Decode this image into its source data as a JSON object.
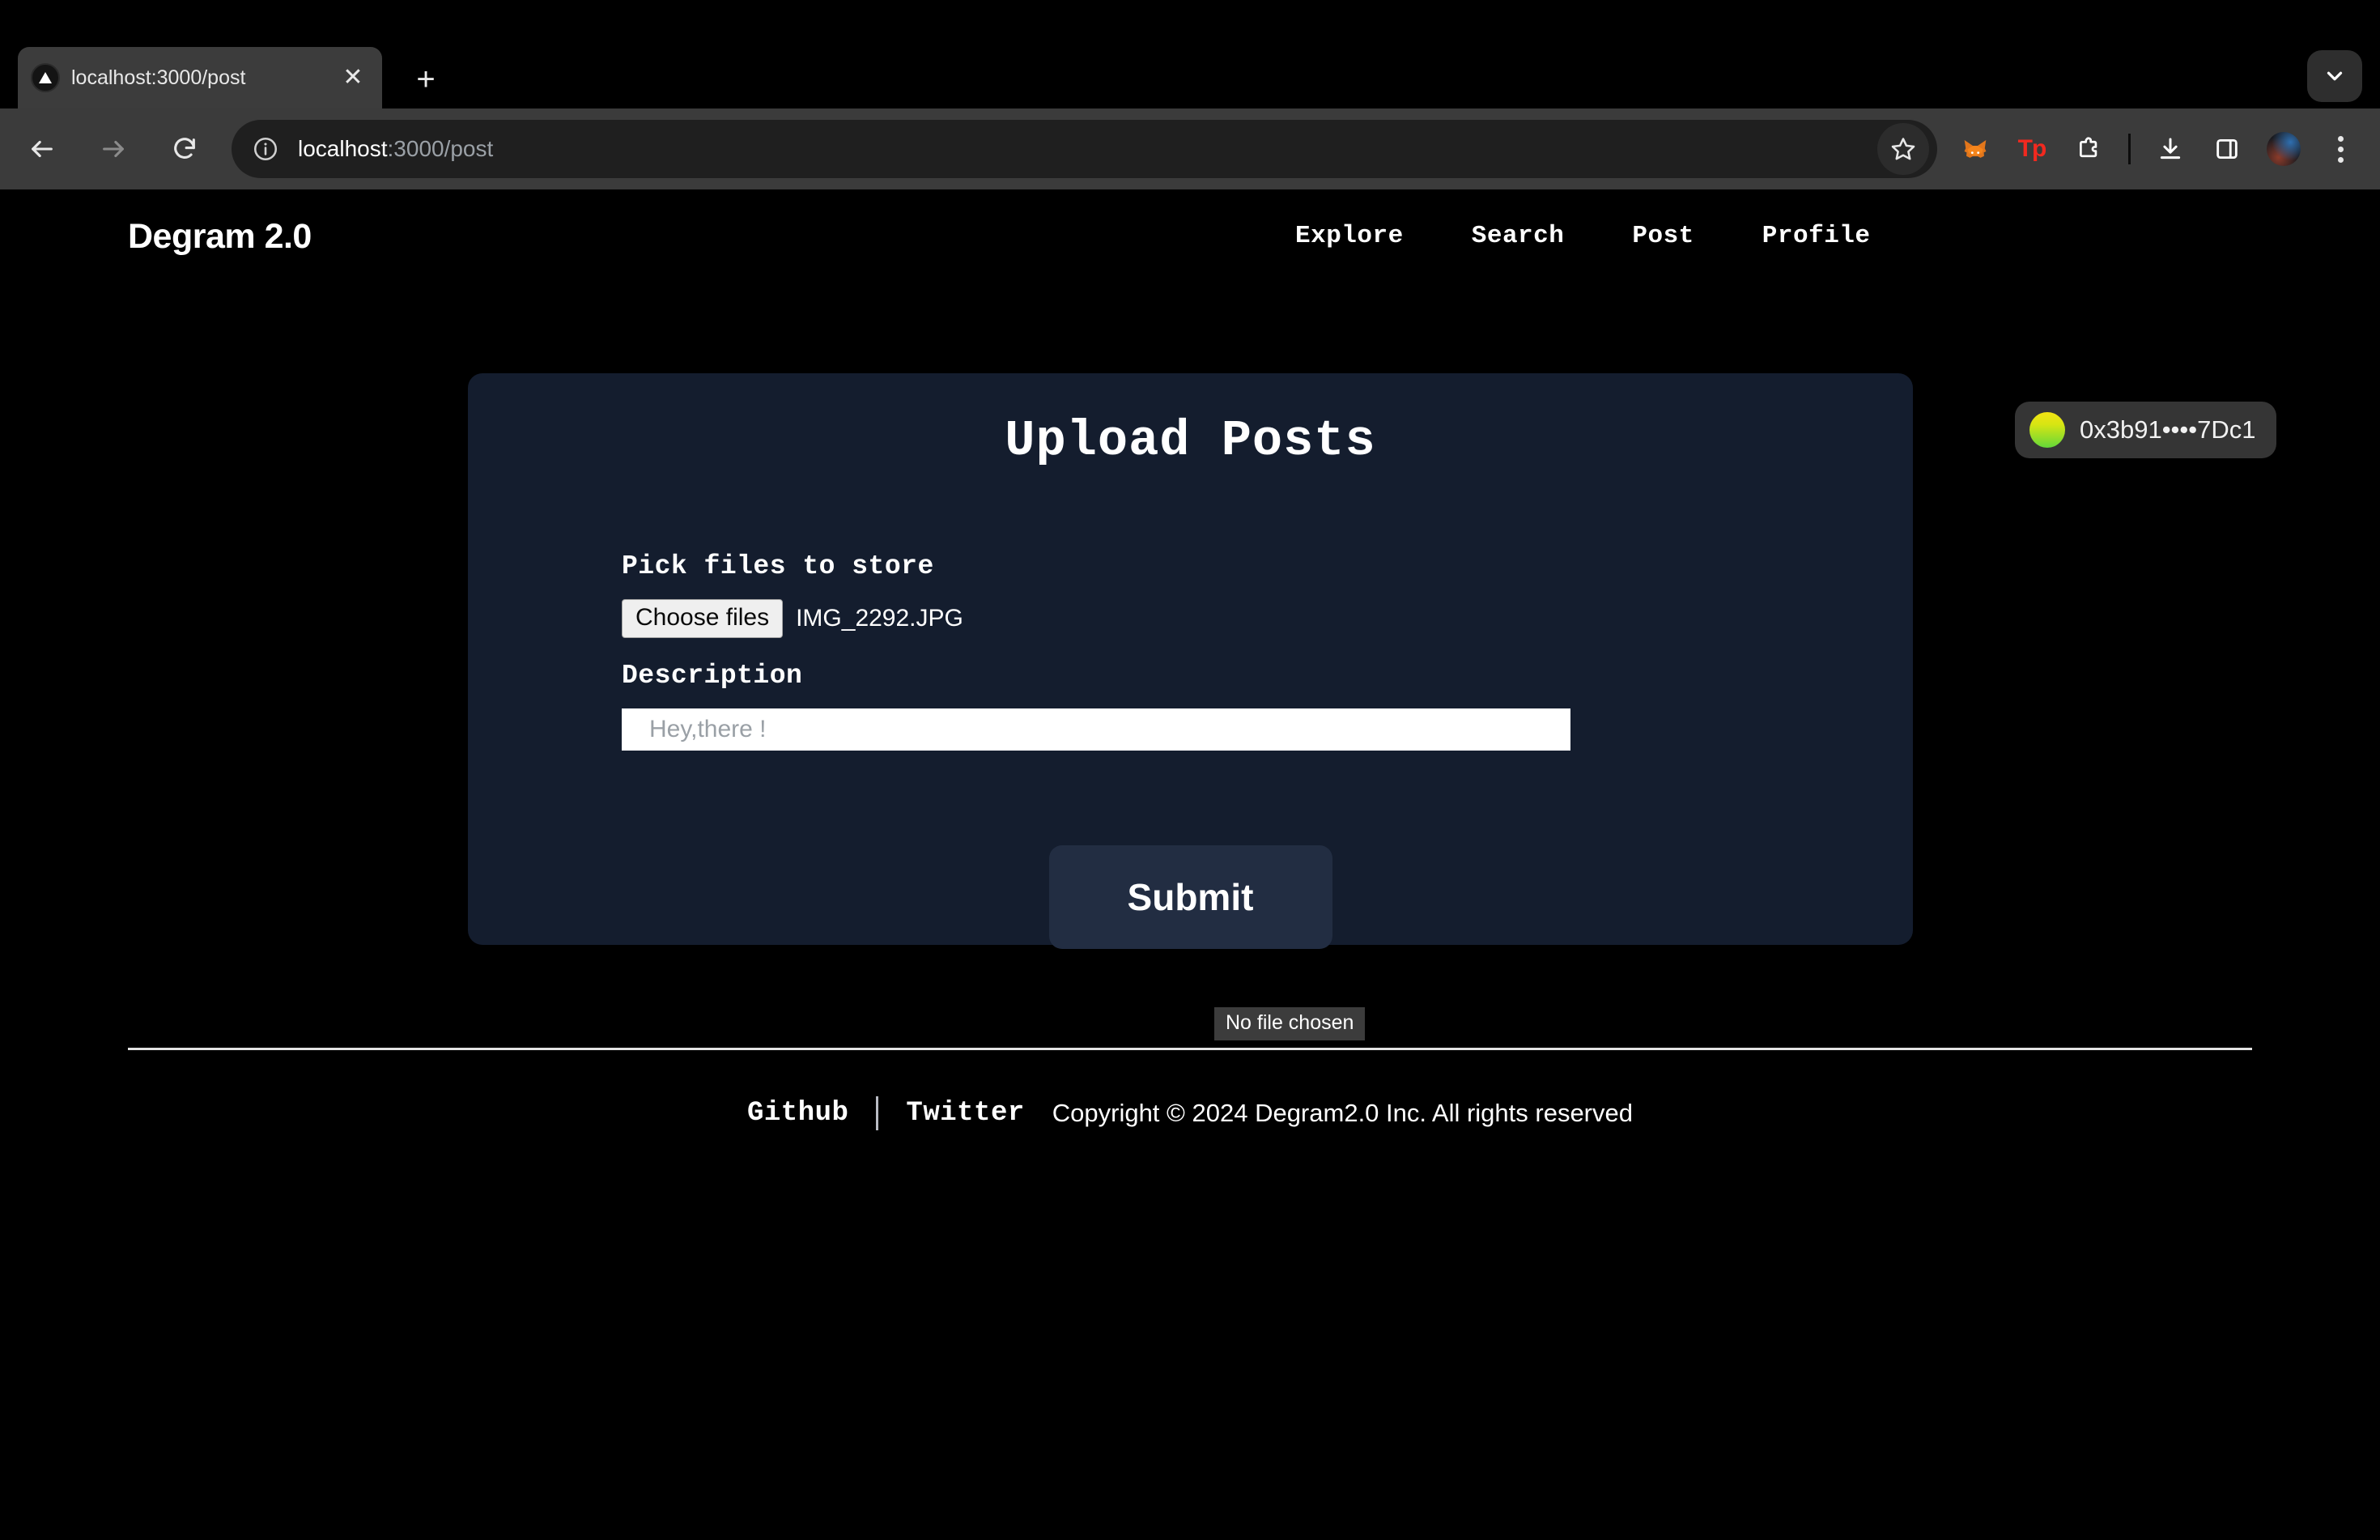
{
  "browser": {
    "tab": {
      "title": "localhost:3000/post",
      "favicon": "nextjs-triangle-icon",
      "close_label": "✕"
    },
    "new_tab_label": "+",
    "tabstrip_chevron": "chevron-down-icon",
    "toolbar": {
      "back": "back-arrow-icon",
      "forward": "forward-arrow-icon",
      "reload": "reload-icon",
      "site_info": "info-circle-icon",
      "url_host": "localhost",
      "url_path": ":3000/post",
      "bookmark": "star-icon",
      "extensions": [
        {
          "name": "metamask-extension-icon",
          "label": ""
        },
        {
          "name": "tokenpocket-extension-icon",
          "label": "Tp"
        },
        {
          "name": "extensions-puzzle-icon",
          "label": ""
        },
        {
          "name": "downloads-icon",
          "label": ""
        },
        {
          "name": "side-panel-icon",
          "label": ""
        },
        {
          "name": "profile-avatar",
          "label": ""
        },
        {
          "name": "chrome-menu-icon",
          "label": ""
        }
      ]
    }
  },
  "site": {
    "brand": "Degram 2.0",
    "nav": [
      {
        "label": "Explore"
      },
      {
        "label": "Search"
      },
      {
        "label": "Post"
      },
      {
        "label": "Profile"
      }
    ],
    "wallet": {
      "address": "0x3b91••••7Dc1",
      "avatar_gradient_from": "#f3e313",
      "avatar_gradient_to": "#63d83a",
      "pill_color": "#353535"
    }
  },
  "main": {
    "card_title": "Upload Posts",
    "card_bg": "#141d2e",
    "file_field": {
      "label": "Pick files to store",
      "button_label": "Choose files",
      "selected_file": "IMG_2292.JPG"
    },
    "description_field": {
      "label": "Description",
      "value": "",
      "placeholder": "Hey,there !"
    },
    "submit_label": "Submit",
    "tooltip_text": "No file chosen"
  },
  "footer": {
    "links": [
      {
        "label": "Github"
      },
      {
        "label": "Twitter"
      }
    ],
    "copyright": "Copyright © 2024 Degram2.0 Inc. All rights reserved"
  }
}
